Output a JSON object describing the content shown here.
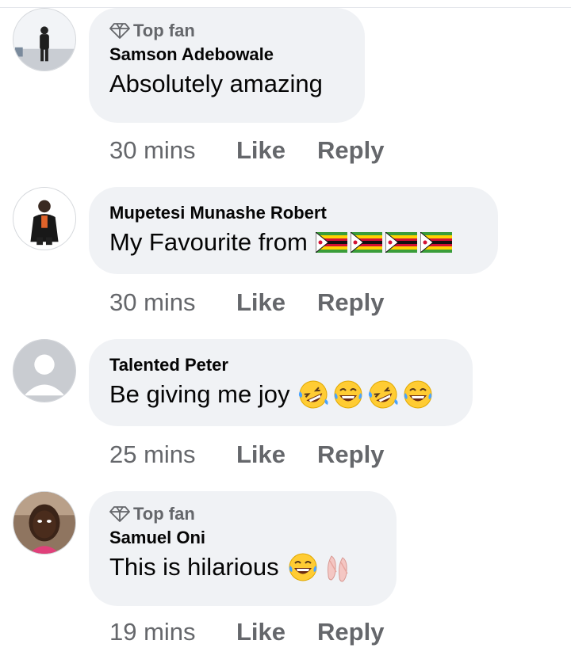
{
  "comments": [
    {
      "badge": "Top fan",
      "author": "Samson Adebowale",
      "text": "Absolutely amazing",
      "emojis": [],
      "time": "30 mins",
      "like_label": "Like",
      "reply_label": "Reply"
    },
    {
      "badge": "",
      "author": "Mupetesi Munashe Robert",
      "text": "My Favourite from",
      "emojis": [
        "zimbabwe-flag-icon",
        "zimbabwe-flag-icon",
        "zimbabwe-flag-icon",
        "zimbabwe-flag-icon"
      ],
      "time": "30 mins",
      "like_label": "Like",
      "reply_label": "Reply"
    },
    {
      "badge": "",
      "author": "Talented Peter",
      "text": "Be giving me joy",
      "emojis": [
        "rolling-laughing-icon",
        "tears-of-joy-icon",
        "rolling-laughing-icon",
        "tears-of-joy-icon"
      ],
      "time": "25 mins",
      "like_label": "Like",
      "reply_label": "Reply"
    },
    {
      "badge": "Top fan",
      "author": "Samuel Oni",
      "text": "This is hilarious",
      "emojis": [
        "tears-of-joy-icon",
        "ballet-shoes-icon"
      ],
      "time": "19 mins",
      "like_label": "Like",
      "reply_label": "Reply"
    }
  ],
  "colors": {
    "bubble": "#f0f2f5",
    "meta_text": "#65676b",
    "primary_text": "#050505"
  }
}
